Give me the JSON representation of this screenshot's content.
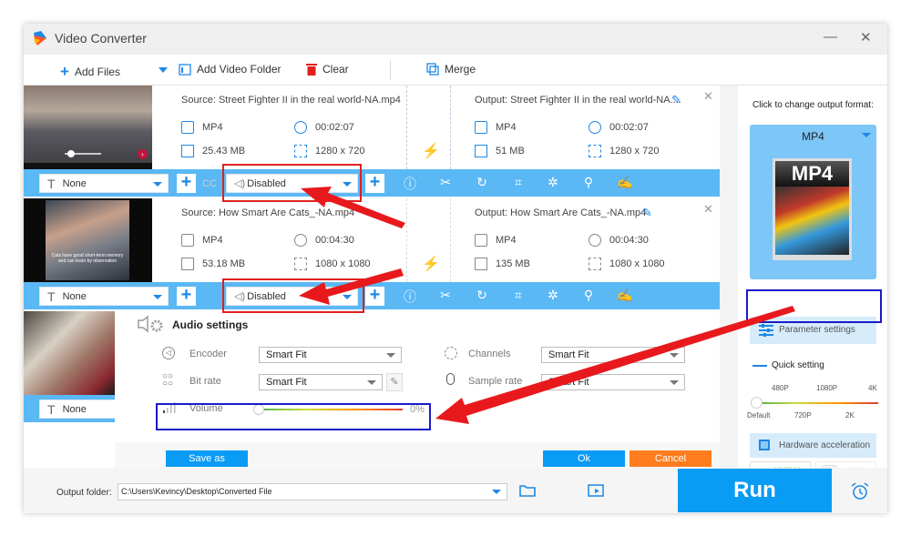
{
  "window": {
    "title": "Video Converter",
    "minimize": "—",
    "close": "✕"
  },
  "toolbar": {
    "add_files": "Add Files",
    "add_video_folder": "Add Video Folder",
    "clear": "Clear",
    "merge": "Merge"
  },
  "items": [
    {
      "source": "Source: Street Fighter II in the real world-NA.mp4",
      "output": "Output: Street Fighter II in the real world-NA....",
      "src_format": "MP4",
      "src_duration": "00:02:07",
      "src_size": "25.43 MB",
      "src_resolution": "1280 x 720",
      "out_format": "MP4",
      "out_duration": "00:02:07",
      "out_size": "51 MB",
      "out_resolution": "1280 x 720",
      "subtitle": "None",
      "audio": "Disabled"
    },
    {
      "source": "Source: How Smart Are Cats_-NA.mp4",
      "output": "Output: How Smart Are Cats_-NA.mp4",
      "src_format": "MP4",
      "src_duration": "00:04:30",
      "src_size": "53.18 MB",
      "src_resolution": "1080 x 1080",
      "out_format": "MP4",
      "out_duration": "00:04:30",
      "out_size": "135 MB",
      "out_resolution": "1080 x 1080",
      "subtitle": "None",
      "audio": "Disabled",
      "thumb_caption": "Cats have good short-term memory and can learn by observation"
    },
    {
      "subtitle": "None"
    }
  ],
  "audio_settings": {
    "title": "Audio settings",
    "encoder_label": "Encoder",
    "encoder_value": "Smart Fit",
    "bitrate_label": "Bit rate",
    "bitrate_value": "Smart Fit",
    "channels_label": "Channels",
    "channels_value": "Smart Fit",
    "samplerate_label": "Sample rate",
    "samplerate_value": "Smart Fit",
    "volume_label": "Volume",
    "volume_value": "0%",
    "volume_fraction": 0,
    "save_as": "Save as",
    "ok": "Ok",
    "cancel": "Cancel"
  },
  "right_panel": {
    "change_format_label": "Click to change output format:",
    "format": "MP4",
    "format_image_text": "MP4",
    "parameter_settings": "Parameter settings",
    "quick_setting": "Quick setting",
    "quality_top": [
      "480P",
      "1080P",
      "4K"
    ],
    "quality_bottom": [
      "Default",
      "720P",
      "2K"
    ],
    "quality_selected": "Default",
    "hardware_acceleration": "Hardware acceleration",
    "nvidia": "NVIDIA",
    "intel": "Intel"
  },
  "bottom": {
    "output_folder_label": "Output folder:",
    "output_folder_value": "C:\\Users\\Kevincy\\Desktop\\Converted File",
    "run": "Run"
  },
  "colors": {
    "accent": "#0a9bf5",
    "bar": "#5ab8f5",
    "cancel": "#ff7d1e",
    "annotation_red": "#e02020",
    "annotation_blue": "#1a1ac8"
  }
}
